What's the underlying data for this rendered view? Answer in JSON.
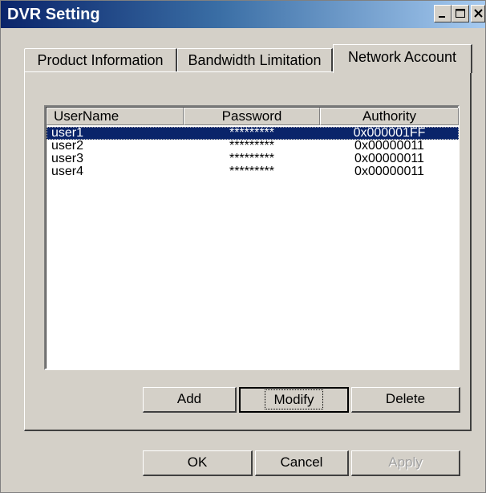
{
  "window": {
    "title": "DVR Setting",
    "controls": [
      "minimize-icon",
      "maximize-icon",
      "close-icon"
    ]
  },
  "tabs": [
    {
      "label": "Product Information",
      "selected": false
    },
    {
      "label": "Bandwidth Limitation",
      "selected": false
    },
    {
      "label": "Network Account",
      "selected": true
    }
  ],
  "accounts": {
    "columns": [
      "UserName",
      "Password",
      "Authority"
    ],
    "rows": [
      {
        "username": "user1",
        "password": "*********",
        "authority": "0x000001FF",
        "selected": true
      },
      {
        "username": "user2",
        "password": "*********",
        "authority": "0x00000011",
        "selected": false
      },
      {
        "username": "user3",
        "password": "*********",
        "authority": "0x00000011",
        "selected": false
      },
      {
        "username": "user4",
        "password": "*********",
        "authority": "0x00000011",
        "selected": false
      }
    ]
  },
  "account_buttons": {
    "add": "Add",
    "modify": "Modify",
    "delete": "Delete"
  },
  "dialog_buttons": {
    "ok": "OK",
    "cancel": "Cancel",
    "apply": "Apply",
    "apply_enabled": false
  },
  "colors": {
    "selection": "#0a246a",
    "face": "#d4d0c8",
    "title_start": "#0a246a",
    "title_end": "#a6caf0"
  }
}
